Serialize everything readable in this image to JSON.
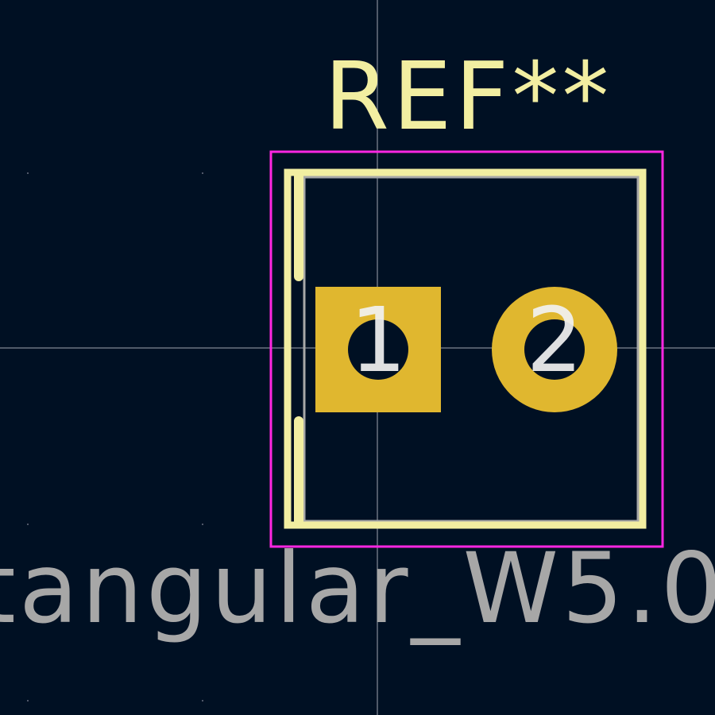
{
  "footprint": {
    "reference": "REF**",
    "value_fragment": "tangular_W5.0",
    "pads": [
      {
        "number": "1",
        "shape": "rect"
      },
      {
        "number": "2",
        "shape": "circle"
      }
    ]
  },
  "colors": {
    "background": "#001023",
    "silkscreen": "#f2eea1",
    "fab_text": "#a7a7a7",
    "courtyard": "#ff26e2",
    "fab_outline": "#a8a8a8",
    "pad": "#e0b72f",
    "crosshair": "#c8c8d2"
  }
}
